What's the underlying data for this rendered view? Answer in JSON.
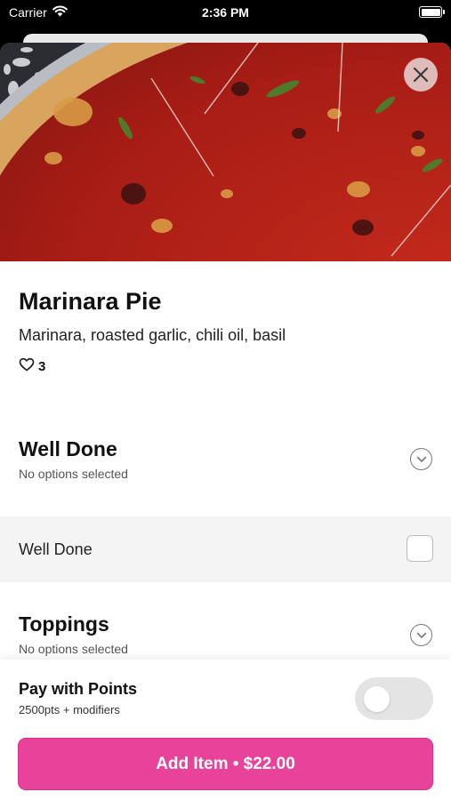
{
  "status_bar": {
    "carrier": "Carrier",
    "time": "2:36 PM",
    "icons": [
      "wifi-icon",
      "battery-icon"
    ]
  },
  "hero": {
    "image": "marinara-pie-photo",
    "close_icon": "close-icon"
  },
  "item": {
    "name": "Marinara Pie",
    "description": "Marinara, roasted garlic, chili oil, basil",
    "likes": "3"
  },
  "modifier_groups": [
    {
      "title": "Well Done",
      "subtitle": "No options selected",
      "options": [
        {
          "label": "Well Done",
          "checked": false
        }
      ]
    },
    {
      "title": "Toppings",
      "subtitle": "No options selected",
      "options": []
    }
  ],
  "pay_with_points": {
    "title": "Pay with Points",
    "subtitle": "2500pts + modifiers",
    "enabled": false
  },
  "add_button": {
    "label": "Add Item • $22.00"
  },
  "colors": {
    "accent": "#e8429b",
    "toggle_off": "#e4e4e4",
    "option_row_bg": "#f4f4f4"
  }
}
